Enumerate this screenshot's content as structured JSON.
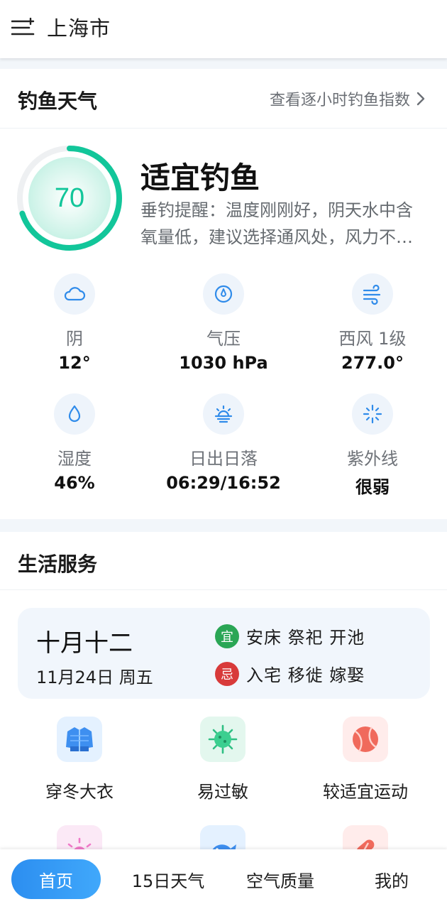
{
  "header": {
    "city": "上海市",
    "menu_icon": "menu-add-icon"
  },
  "fishing": {
    "title": "钓鱼天气",
    "hourly_link": "查看逐小时钓鱼指数",
    "score": "70",
    "score_fraction": 0.7,
    "status": "适宜钓鱼",
    "tip": "垂钓提醒：温度刚刚好，阴天水中含氧量低，建议选择通风处，风力不大的水域垂钓。",
    "accent_color": "#12c69a",
    "metrics": [
      {
        "icon": "cloud-icon",
        "label": "阴",
        "value": "12°"
      },
      {
        "icon": "pressure-icon",
        "label": "气压",
        "value": "1030 hPa"
      },
      {
        "icon": "wind-icon",
        "label": "西风 1级",
        "value": "277.0°"
      },
      {
        "icon": "humidity-icon",
        "label": "湿度",
        "value": "46%"
      },
      {
        "icon": "sunrise-icon",
        "label": "日出日落",
        "value": "06:29/16:52"
      },
      {
        "icon": "uv-icon",
        "label": "紫外线",
        "value": "很弱"
      }
    ]
  },
  "life": {
    "title": "生活服务",
    "almanac": {
      "lunar_date": "十月十二",
      "gregorian_date": "11月24日 周五",
      "yi_label": "宜",
      "yi_text": "安床 祭祀 开池",
      "ji_label": "忌",
      "ji_text": "入宅 移徙 嫁娶",
      "yi_color": "#2aa655",
      "ji_color": "#d83a3a"
    },
    "services": [
      {
        "icon": "coat-icon",
        "label": "穿冬大衣"
      },
      {
        "icon": "allergy-icon",
        "label": "易过敏"
      },
      {
        "icon": "ball-icon",
        "label": "较适宜运动"
      },
      {
        "icon": "sun-icon",
        "label": ""
      },
      {
        "icon": "fish-icon",
        "label": ""
      },
      {
        "icon": "pill-icon",
        "label": ""
      }
    ]
  },
  "nav": {
    "items": [
      {
        "label": "首页",
        "active": true
      },
      {
        "label": "15日天气",
        "active": false
      },
      {
        "label": "空气质量",
        "active": false
      },
      {
        "label": "我的",
        "active": false
      }
    ],
    "active_color": "#2c8ef0"
  }
}
